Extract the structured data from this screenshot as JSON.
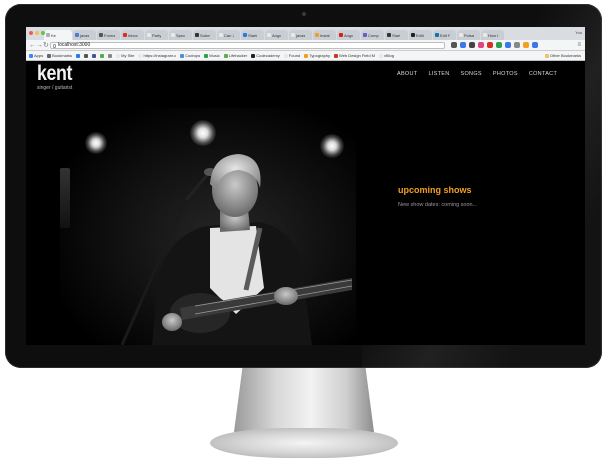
{
  "browser": {
    "tabs": [
      {
        "title": "Ke",
        "active": true,
        "color": "#b0b0b0"
      },
      {
        "title": "javas",
        "active": false,
        "color": "#4a7bd6"
      },
      {
        "title": "Forms",
        "active": false,
        "color": "#555555"
      },
      {
        "title": "Inbox",
        "active": false,
        "color": "#d93025"
      },
      {
        "title": "Party",
        "active": false,
        "color": "#e8e8e8"
      },
      {
        "title": "Spec",
        "active": false,
        "color": "#e8e8e8"
      },
      {
        "title": "Subm",
        "active": false,
        "color": "#333333"
      },
      {
        "title": "Can J",
        "active": false,
        "color": "#e8e8e8"
      },
      {
        "title": "Starti",
        "active": false,
        "color": "#2a7ae2"
      },
      {
        "title": "Angu",
        "active": false,
        "color": "#e8e8e8"
      },
      {
        "title": "javas",
        "active": false,
        "color": "#e8e8e8"
      },
      {
        "title": "Instal",
        "active": false,
        "color": "#f0a020"
      },
      {
        "title": "Angu",
        "active": false,
        "color": "#dd1b16"
      },
      {
        "title": "Comp",
        "active": false,
        "color": "#6a5acd"
      },
      {
        "title": "Start",
        "active": false,
        "color": "#333333"
      },
      {
        "title": "Editi",
        "active": false,
        "color": "#222222"
      },
      {
        "title": "Edit F",
        "active": false,
        "color": "#0e76a8"
      },
      {
        "title": "Pulsa",
        "active": false,
        "color": "#e8e8e8"
      },
      {
        "title": "How t",
        "active": false,
        "color": "#e8e8e8"
      }
    ],
    "user_label": "You",
    "back_icon": "back-arrow-icon",
    "forward_icon": "forward-arrow-icon",
    "reload_icon": "reload-icon",
    "url": "localhost:3000",
    "extension_colors": [
      "#555555",
      "#3b78e7",
      "#444444",
      "#e0457b",
      "#d93025",
      "#2e9e4f",
      "#3b78e7",
      "#888888",
      "#f0a020",
      "#3b78e7"
    ],
    "bookmarks": [
      {
        "label": "Apps",
        "color": "#4285f4"
      },
      {
        "label": "Bookmarks",
        "color": "#666666"
      },
      {
        "label": "",
        "color": "#2a7ae2"
      },
      {
        "label": "",
        "color": "#555555"
      },
      {
        "label": "",
        "color": "#3b5998"
      },
      {
        "label": "",
        "color": "#4caf50"
      },
      {
        "label": "",
        "color": "#888888"
      },
      {
        "label": "My Site",
        "color": "#e8e8e8"
      },
      {
        "label": "https://instagram.c",
        "color": "#e8e8e8"
      },
      {
        "label": "Codrops",
        "color": "#4a90d9"
      },
      {
        "label": "Music",
        "color": "#2e9e4f"
      },
      {
        "label": "Lifehacker",
        "color": "#6aa84f"
      },
      {
        "label": "Codecademy",
        "color": "#222222"
      },
      {
        "label": "Found",
        "color": "#e8e8e8"
      },
      {
        "label": "Typography",
        "color": "#f0a020"
      },
      {
        "label": "Web Design Field M",
        "color": "#d93025"
      },
      {
        "label": "vBlog",
        "color": "#e8e8e8"
      }
    ],
    "other_bookmarks": "Other Bookmarks"
  },
  "site": {
    "logo": "kent",
    "tagline": "singer / guitarist",
    "nav": [
      "ABOUT",
      "LISTEN",
      "SONGS",
      "PHOTOS",
      "CONTACT"
    ],
    "shows_title": "upcoming shows",
    "shows_text": "New show dates: coming soon..."
  },
  "colors": {
    "accent": "#f0a020",
    "background": "#000000",
    "nav_text": "#dddddd"
  }
}
